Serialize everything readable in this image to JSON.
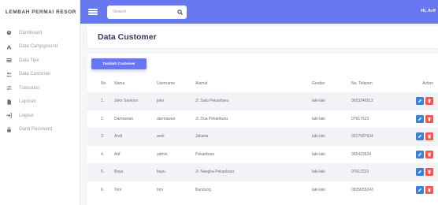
{
  "sidebar": {
    "brand": "LEMBAH PERMAI RESOR",
    "items": [
      {
        "label": "Dashboard",
        "icon": "palette-icon"
      },
      {
        "label": "Data Campground",
        "icon": "tent-icon"
      },
      {
        "label": "Data Tipe",
        "icon": "list-icon"
      },
      {
        "label": "Data Customer",
        "icon": "users-icon"
      },
      {
        "label": "Transaksi",
        "icon": "exchange-icon"
      },
      {
        "label": "Laporan",
        "icon": "file-icon"
      },
      {
        "label": "Logout",
        "icon": "logout-icon"
      },
      {
        "label": "Ganti Password",
        "icon": "lock-icon"
      }
    ]
  },
  "topbar": {
    "search_placeholder": "Search",
    "user": "Hi, Arif"
  },
  "page": {
    "title": "Data Customer",
    "add_button": "Tambah Customer"
  },
  "table": {
    "headers": [
      "No",
      "Nama",
      "Username",
      "Alamat",
      "Gender",
      "No. Telepon",
      "Action"
    ],
    "rows": [
      {
        "no": "1.",
        "nama": "Joko Santoso",
        "username": "joko",
        "alamat": "Jl. Satu Pekanbaru",
        "gender": "laki-laki",
        "telepon": "0653246512"
      },
      {
        "no": "2.",
        "nama": "Darmawan",
        "username": "darmawan",
        "alamat": "Jl. Dua Pekanbaru",
        "gender": "laki-laki",
        "telepon": "07617623"
      },
      {
        "no": "3.",
        "nama": "Andi",
        "username": "andi",
        "alamat": "Jakarta",
        "gender": "laki-laki",
        "telepon": "0217687634"
      },
      {
        "no": "4.",
        "nama": "Arif",
        "username": "admin",
        "alamat": "Pekanbaru",
        "gender": "laki-laki",
        "telepon": "065423624"
      },
      {
        "no": "5.",
        "nama": "Bayu",
        "username": "bayu",
        "alamat": "Jl. Nangka Pekanbaru",
        "gender": "laki-laki",
        "telepon": "07612233"
      },
      {
        "no": "6.",
        "nama": "Toni",
        "username": "toni",
        "alamat": "Bandung",
        "gender": "laki-laki",
        "telepon": "0835655243"
      }
    ]
  },
  "colors": {
    "primary": "#6777ef",
    "edit": "#3b82d6",
    "delete": "#fc544b"
  }
}
